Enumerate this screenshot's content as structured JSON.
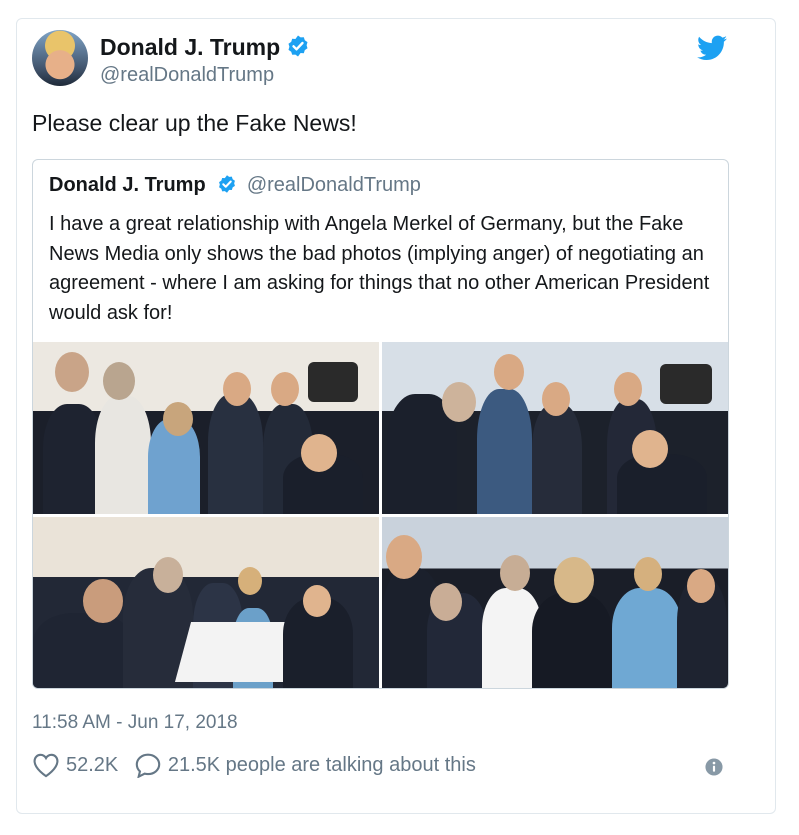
{
  "tweet": {
    "author_name": "Donald J. Trump",
    "handle": "@realDonaldTrump",
    "text": "Please clear up the Fake News!",
    "timestamp": "11:58 AM - Jun 17, 2018",
    "likes": "52.2K",
    "replies": "21.5K people are talking about this",
    "icons": {
      "verified": "verified-badge-icon",
      "logo": "twitter-bird-icon",
      "like": "heart-icon",
      "reply": "speech-bubble-icon",
      "info": "info-icon"
    }
  },
  "quoted_tweet": {
    "author_name": "Donald J. Trump",
    "handle": "@realDonaldTrump",
    "text": "I have a great relationship with Angela Merkel of Germany, but the Fake News Media only shows the bad photos (implying anger) of negotiating an agreement - where I am asking for things that no other American President would ask for!",
    "photo_count": 4
  },
  "colors": {
    "verified_blue": "#1da1f2",
    "secondary_text": "#657786",
    "border": "#e1e8ed"
  }
}
